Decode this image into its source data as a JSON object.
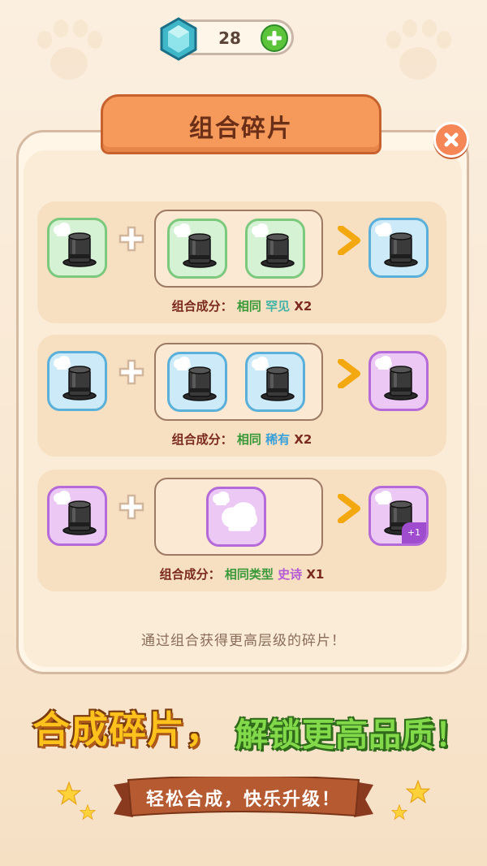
{
  "currency": {
    "icon": "gem-icon",
    "count": "28",
    "add_icon": "plus-icon"
  },
  "dialog": {
    "title": "组合碎片",
    "close_icon": "close-icon",
    "recipes": [
      {
        "label": "组合成分：",
        "same": "相同",
        "rarity": "罕见",
        "mult": "X2"
      },
      {
        "label": "组合成分：",
        "same": "相同",
        "rarity": "稀有",
        "mult": "X2"
      },
      {
        "label": "组合成分：",
        "same": "相同类型",
        "rarity": "史诗",
        "mult": "X1",
        "bonus": "+1"
      }
    ],
    "hint": "通过组合获得更高层级的碎片！"
  },
  "banner": {
    "slogan_a": "合成碎片，",
    "slogan_b": "解锁更高品质！",
    "ribbon": "轻松合成，快乐升级！"
  },
  "colors": {
    "green_tile": "#d6f2d4",
    "blue_tile": "#cdeaf8",
    "purple_tile": "#ecc8f4",
    "accent": "#f59a5a"
  }
}
